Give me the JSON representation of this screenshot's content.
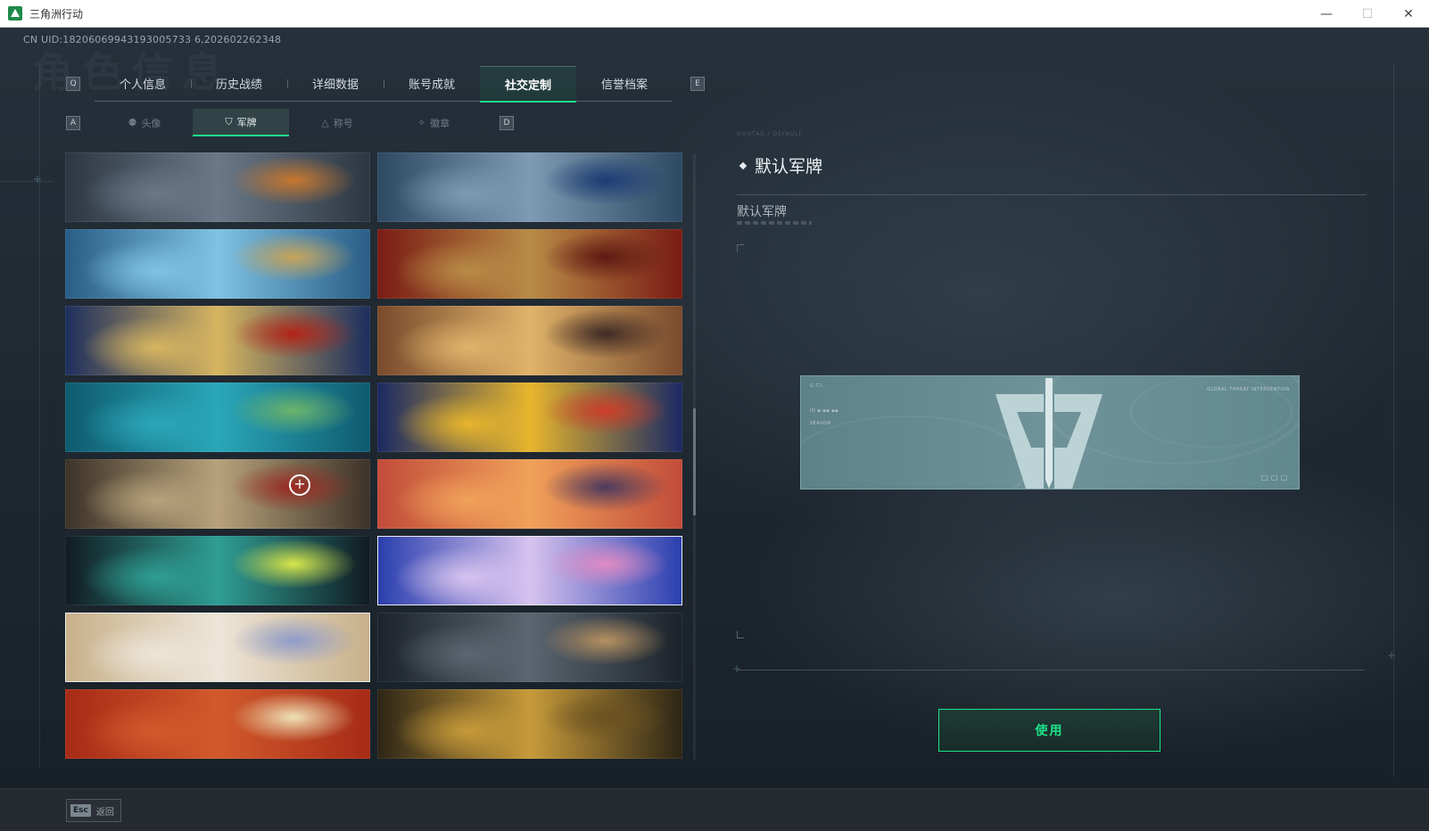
{
  "window": {
    "title": "三角洲行动",
    "controls": {
      "minimize": "—",
      "maximize": "☐",
      "close": "✕"
    }
  },
  "header": {
    "uid_text": "CN UID:18206069943193005733 6,202602262348",
    "bg_title": "角色信息"
  },
  "main_tabs": {
    "key_left": "Q",
    "key_right": "E",
    "items": [
      {
        "label": "个人信息",
        "active": false
      },
      {
        "label": "历史战绩",
        "active": false
      },
      {
        "label": "详细数据",
        "active": false
      },
      {
        "label": "账号成就",
        "active": false
      },
      {
        "label": "社交定制",
        "active": true
      },
      {
        "label": "信誉档案",
        "active": false
      }
    ]
  },
  "sub_tabs": {
    "key_left": "A",
    "key_right": "D",
    "items": [
      {
        "label": "头像",
        "icon": "person-icon",
        "glyph": "⚉",
        "active": false
      },
      {
        "label": "军牌",
        "icon": "dogtag-icon",
        "glyph": "⛉",
        "active": true
      },
      {
        "label": "称号",
        "icon": "title-icon",
        "glyph": "△",
        "active": false
      },
      {
        "label": "徽章",
        "icon": "badge-icon",
        "glyph": "✧",
        "active": false
      }
    ]
  },
  "banners": [
    {
      "name": "banner-soldiers-laser",
      "colors": [
        "#2d3742",
        "#6a7887",
        "#c7772e"
      ]
    },
    {
      "name": "banner-naval-base",
      "colors": [
        "#2e4a63",
        "#7e9bb3",
        "#1d3a74"
      ]
    },
    {
      "name": "banner-blue-flowers",
      "colors": [
        "#2a5d86",
        "#7fc2e4",
        "#c7a45a"
      ]
    },
    {
      "name": "banner-red-roses",
      "colors": [
        "#7a1c14",
        "#b88b46",
        "#5e1a12"
      ]
    },
    {
      "name": "banner-gold-jewel",
      "colors": [
        "#1d2f5e",
        "#d7b560",
        "#b22418"
      ]
    },
    {
      "name": "banner-cartoon-party",
      "colors": [
        "#7a4b2d",
        "#e0b36a",
        "#3f2a25"
      ]
    },
    {
      "name": "banner-tropical-sea",
      "colors": [
        "#0f5b6f",
        "#2aa7b9",
        "#6cb46a"
      ]
    },
    {
      "name": "banner-festival-hero",
      "colors": [
        "#1b2a63",
        "#e7b52d",
        "#cc3d2a"
      ]
    },
    {
      "name": "banner-sniper-kitchen",
      "colors": [
        "#3d3328",
        "#b8a27c",
        "#9a2a22"
      ]
    },
    {
      "name": "banner-sunset-camp",
      "colors": [
        "#c24c3a",
        "#f0a15a",
        "#4b3a5e"
      ]
    },
    {
      "name": "banner-graffiti",
      "colors": [
        "#111c22",
        "#2f9e94",
        "#d7e64a"
      ]
    },
    {
      "name": "banner-anime-girl",
      "colors": [
        "#2a3fae",
        "#d7c3ef",
        "#e08ac3"
      ]
    },
    {
      "name": "banner-dove-wheat",
      "colors": [
        "#c8b08a",
        "#ede5d8",
        "#8f9bc9"
      ]
    },
    {
      "name": "banner-soldier-city",
      "colors": [
        "#1c232a",
        "#5c6670",
        "#b69060"
      ]
    },
    {
      "name": "banner-white-snake",
      "colors": [
        "#a62b17",
        "#d15a2b",
        "#efe2b6"
      ]
    },
    {
      "name": "banner-gold-warrior",
      "colors": [
        "#2e2616",
        "#c79a3a",
        "#6b5221"
      ]
    }
  ],
  "detail": {
    "tag": "DOGTAG / DEFAULT",
    "title": "默认军牌",
    "name": "默认军牌",
    "preview_colors": {
      "base": "#6f9399",
      "logo": "#bcd3d6"
    },
    "preview_labels": {
      "top_left": "G.T.I.",
      "mid_left": "ID ▪ ▪▪ ▪▪",
      "small_left": "SEASON",
      "top_right": "GLOBAL THREAT INTERVENTION",
      "bottom_right": "□ □ □"
    }
  },
  "actions": {
    "use_label": "使用"
  },
  "footer": {
    "esc_key": "Esc",
    "back_label": "返回"
  },
  "colors": {
    "accent": "#1ee58a",
    "panel": "#242a30"
  }
}
